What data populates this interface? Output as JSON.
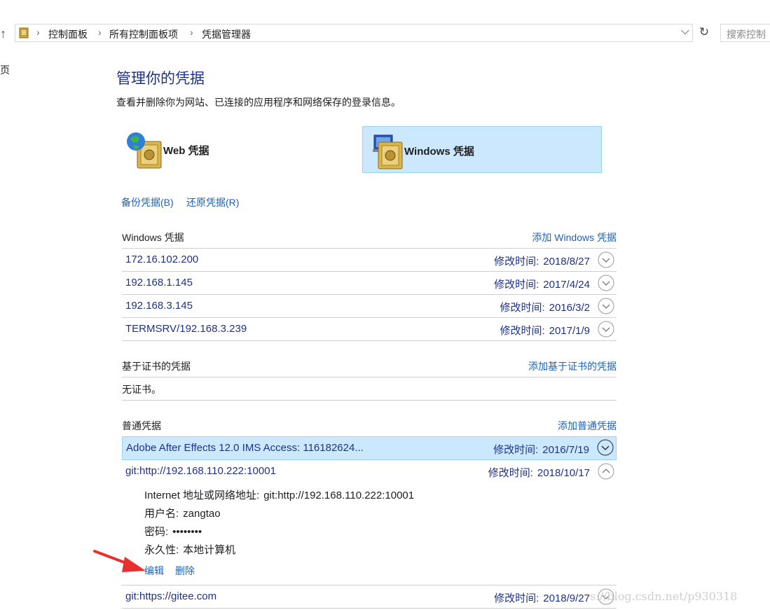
{
  "nav": {
    "up_icon": "up-arrow-icon",
    "breadcrumbs": [
      "控制面板",
      "所有控制面板项",
      "凭据管理器"
    ],
    "search_placeholder": "搜索控制",
    "left_cut_text": "页"
  },
  "header": {
    "title": "管理你的凭据",
    "description": "查看并删除你为网站、已连接的应用程序和网络保存的登录信息。"
  },
  "vaults": {
    "web_label": "Web 凭据",
    "windows_label": "Windows 凭据",
    "selected": "windows"
  },
  "backup": {
    "backup_label": "备份凭据(B)",
    "restore_label": "还原凭据(R)"
  },
  "windows_section": {
    "heading": "Windows 凭据",
    "add_label": "添加 Windows 凭据",
    "items": [
      {
        "name": "172.16.102.200",
        "modified_label": "修改时间:",
        "modified": "2018/8/27"
      },
      {
        "name": "192.168.1.145",
        "modified_label": "修改时间:",
        "modified": "2017/4/24"
      },
      {
        "name": "192.168.3.145",
        "modified_label": "修改时间:",
        "modified": "2016/3/2"
      },
      {
        "name": "TERMSRV/192.168.3.239",
        "modified_label": "修改时间:",
        "modified": "2017/1/9"
      }
    ]
  },
  "cert_section": {
    "heading": "基于证书的凭据",
    "add_label": "添加基于证书的凭据",
    "empty_text": "无证书。"
  },
  "generic_section": {
    "heading": "普通凭据",
    "add_label": "添加普通凭据",
    "items": [
      {
        "name": "Adobe After Effects 12.0 IMS Access: 116182624...",
        "modified_label": "修改时间:",
        "modified": "2016/7/19",
        "selected": true
      },
      {
        "name": "git:http://192.168.110.222:10001",
        "modified_label": "修改时间:",
        "modified": "2018/10/17",
        "expanded": true
      },
      {
        "name": "git:https://gitee.com",
        "modified_label": "修改时间:",
        "modified": "2018/9/27"
      }
    ],
    "expanded_detail": {
      "address_label": "Internet 地址或网络地址:",
      "address": "git:http://192.168.110.222:10001",
      "username_label": "用户名:",
      "username": "zangtao",
      "password_label": "密码:",
      "password": "••••••••",
      "persistence_label": "永久性:",
      "persistence": "本地计算机",
      "edit_label": "编辑",
      "delete_label": "删除"
    }
  },
  "watermark": "s://blog.csdn.net/p930318",
  "colors": {
    "accent_text": "#1e3287",
    "link": "#1c62b9",
    "selection": "#cce8ff",
    "selection_border": "#99d1ff",
    "annotation_arrow": "#e8312f"
  }
}
